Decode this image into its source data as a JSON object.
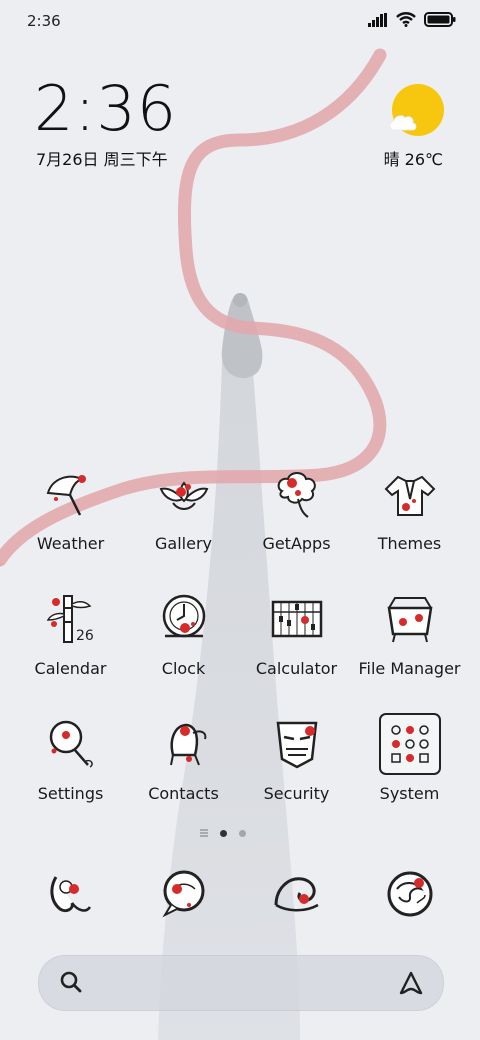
{
  "status_bar": {
    "time": "2:36"
  },
  "clock_widget": {
    "time": "2:36",
    "date": "7月26日 周三下午"
  },
  "weather_widget": {
    "condition_icon": "sun-cloud-icon",
    "text": "晴 26℃"
  },
  "apps": [
    {
      "label": "Weather",
      "icon": "umbrella-icon"
    },
    {
      "label": "Gallery",
      "icon": "lotus-icon"
    },
    {
      "label": "GetApps",
      "icon": "cloud-knot-icon"
    },
    {
      "label": "Themes",
      "icon": "robe-icon"
    },
    {
      "label": "Calendar",
      "icon": "bamboo-calendar-icon",
      "badge": "26"
    },
    {
      "label": "Clock",
      "icon": "clock-icon"
    },
    {
      "label": "Calculator",
      "icon": "abacus-icon"
    },
    {
      "label": "File Manager",
      "icon": "basket-icon"
    },
    {
      "label": "Settings",
      "icon": "fan-icon"
    },
    {
      "label": "Contacts",
      "icon": "warrior-icon"
    },
    {
      "label": "Security",
      "icon": "mask-icon"
    },
    {
      "label": "System",
      "icon": "system-grid-icon"
    }
  ],
  "dock": [
    {
      "icon": "phone-swirl-icon"
    },
    {
      "icon": "message-swirl-icon"
    },
    {
      "icon": "browser-wave-icon"
    },
    {
      "icon": "camera-swirl-icon"
    }
  ],
  "page_indicator": {
    "pages": 2,
    "current": 1
  },
  "colors": {
    "accent_red": "#d62b2b",
    "ribbon": "#e2a9ad",
    "background": "#eceef2",
    "sun": "#f7c70f"
  }
}
